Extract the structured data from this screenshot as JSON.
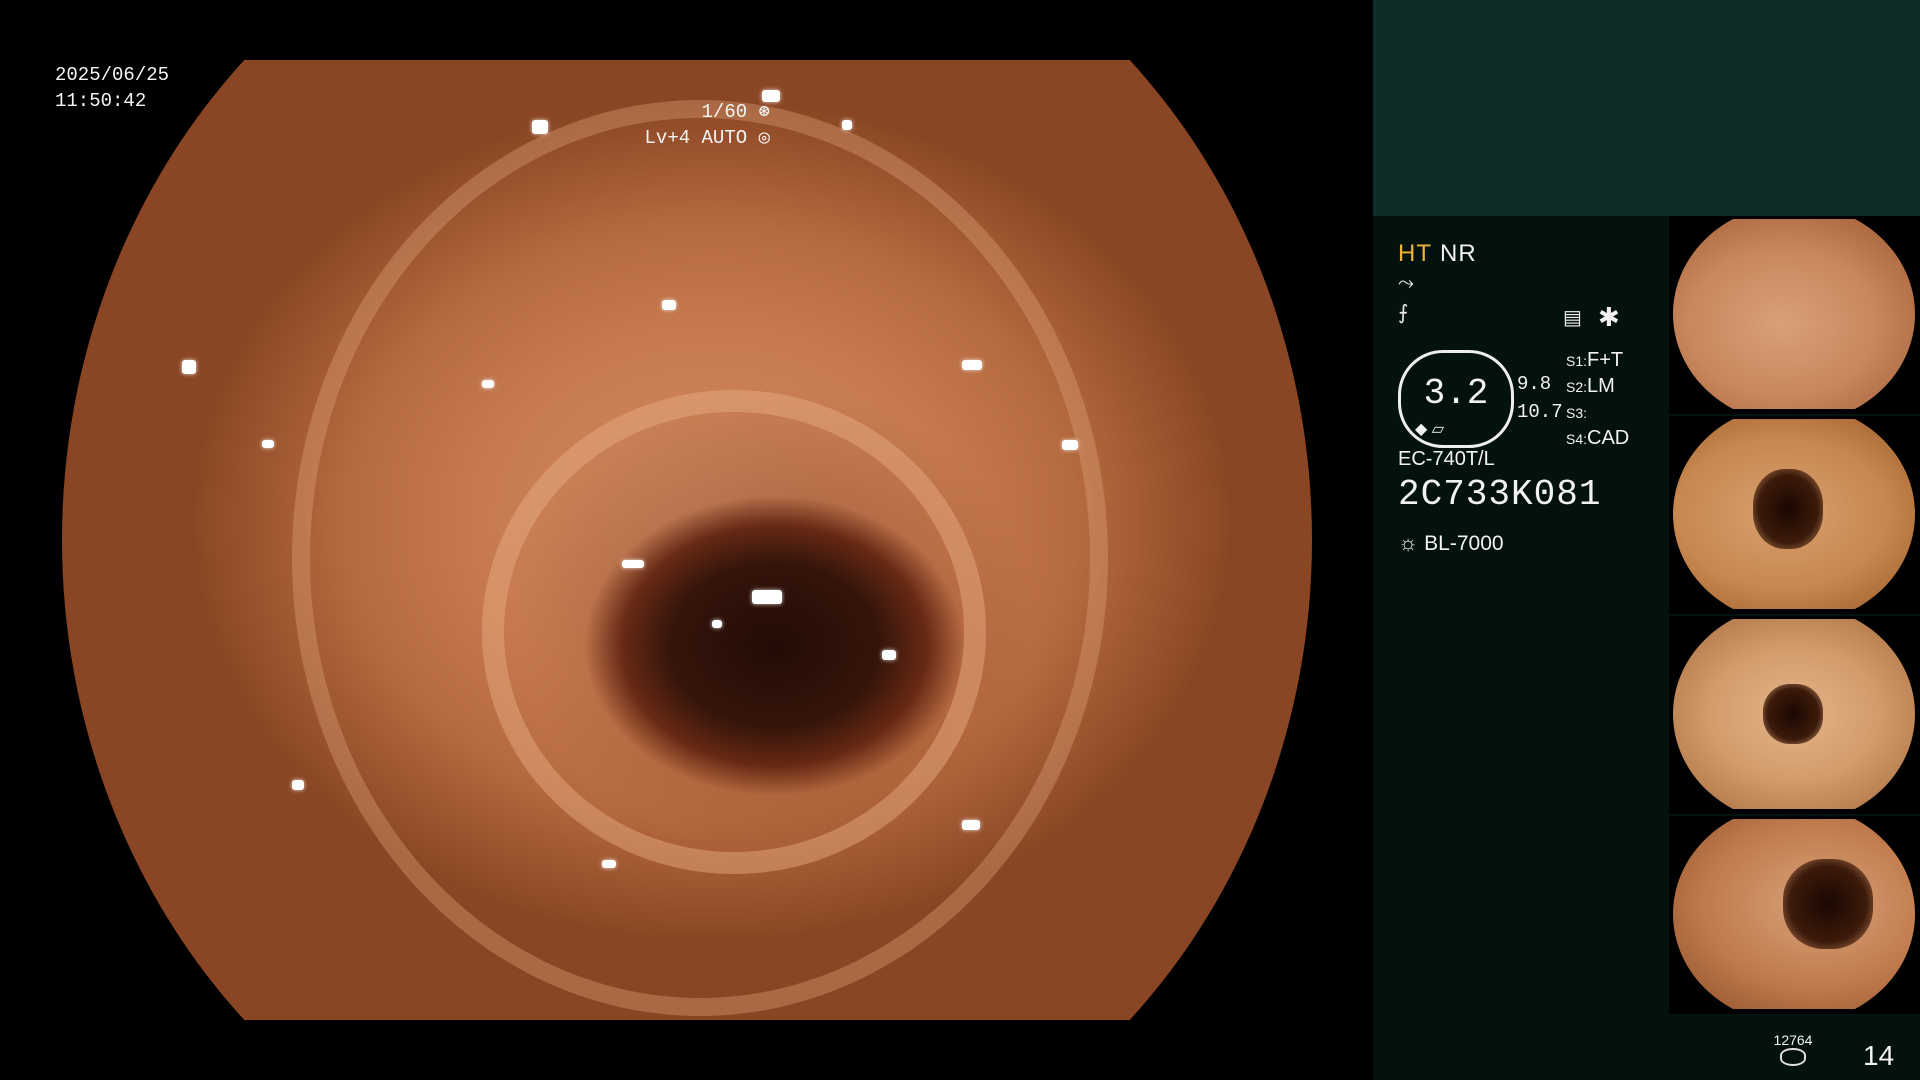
{
  "overlay": {
    "date": "2025/06/25",
    "time": "11:50:42",
    "shutter": "1/60",
    "shutter_icon": "aperture-icon",
    "level": "Lv+4 AUTO",
    "level_icon": "auto-iris-icon"
  },
  "panel": {
    "mode_ht": "HT",
    "mode_nr": "NR",
    "icon_1": "⤳",
    "icon_2": "⨍",
    "gauge_value": "3.2",
    "gauge_side": [
      "9.8",
      "10.7"
    ],
    "settings_icon": "▤",
    "star_symbol": "✱",
    "s_items": [
      {
        "key": "S1",
        "value": "F+T"
      },
      {
        "key": "S2",
        "value": "LM"
      },
      {
        "key": "S3",
        "value": ""
      },
      {
        "key": "S4",
        "value": "CAD"
      }
    ],
    "scope_model": "EC-740T/L",
    "serial": "2C733K081",
    "light_source": "BL-7000",
    "light_icon": "☼"
  },
  "footer": {
    "storage_count": "12764",
    "page": "14"
  },
  "colors": {
    "panel_bg": "#04120f",
    "panel_header": "#0e2c28",
    "ht_accent": "#f0b23a"
  }
}
